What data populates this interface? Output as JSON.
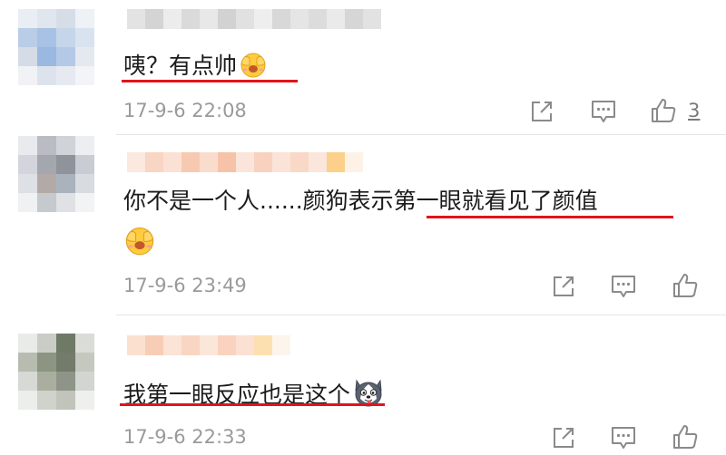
{
  "comments": [
    {
      "text": "咦？有点帅",
      "emoji": "covering-face-emoji",
      "time": "17-9-6 22:08",
      "like_count": "3"
    },
    {
      "text_line1": "你不是一个人......颜狗表示第一眼就看见了颜值",
      "emoji": "covering-face-emoji",
      "time": "17-9-6 23:49",
      "like_count": ""
    },
    {
      "text": "我第一眼反应也是这个",
      "emoji": "husky-face-emoji",
      "time": "17-9-6 22:33",
      "like_count": ""
    }
  ],
  "icons": {
    "share": "share-icon",
    "reply": "reply-icon",
    "like": "thumbs-up-icon"
  },
  "colors": {
    "underline": "#e0141c",
    "time": "#9a9a9a",
    "text": "#1b1b1b"
  }
}
